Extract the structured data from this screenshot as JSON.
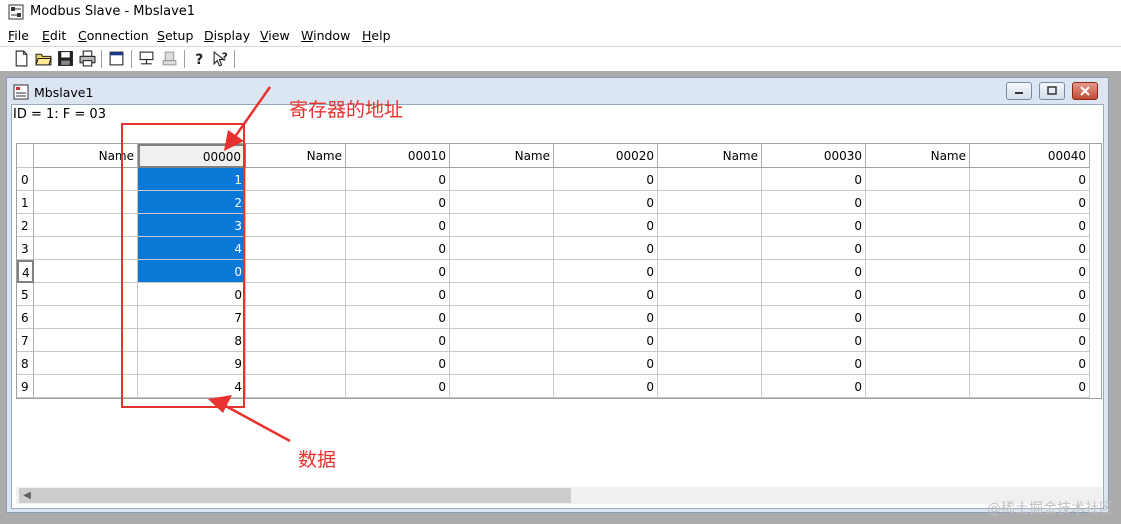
{
  "app": {
    "title": "Modbus Slave - Mbslave1"
  },
  "menu": {
    "items": [
      "File",
      "Edit",
      "Connection",
      "Setup",
      "Display",
      "View",
      "Window",
      "Help"
    ]
  },
  "toolbar": {
    "buttons": [
      "new-icon",
      "open-icon",
      "save-icon",
      "print-icon",
      "window-icon",
      "connect-icon",
      "disconnect-icon",
      "help-icon",
      "context-help-icon"
    ]
  },
  "child_window": {
    "title": "Mbslave1",
    "status": "ID = 1: F = 03",
    "colors": {
      "selection": "#0a78d7",
      "annotation": "#e8322f"
    }
  },
  "grid": {
    "headers": [
      "Name",
      "00000",
      "Name",
      "00010",
      "Name",
      "00020",
      "Name",
      "00030",
      "Name",
      "00040"
    ],
    "row_labels": [
      "0",
      "1",
      "2",
      "3",
      "4",
      "5",
      "6",
      "7",
      "8",
      "9"
    ],
    "rows": [
      [
        "",
        "1",
        "",
        "0",
        "",
        "0",
        "",
        "0",
        "",
        "0"
      ],
      [
        "",
        "2",
        "",
        "0",
        "",
        "0",
        "",
        "0",
        "",
        "0"
      ],
      [
        "",
        "3",
        "",
        "0",
        "",
        "0",
        "",
        "0",
        "",
        "0"
      ],
      [
        "",
        "4",
        "",
        "0",
        "",
        "0",
        "",
        "0",
        "",
        "0"
      ],
      [
        "",
        "0",
        "",
        "0",
        "",
        "0",
        "",
        "0",
        "",
        "0"
      ],
      [
        "",
        "0",
        "",
        "0",
        "",
        "0",
        "",
        "0",
        "",
        "0"
      ],
      [
        "",
        "7",
        "",
        "0",
        "",
        "0",
        "",
        "0",
        "",
        "0"
      ],
      [
        "",
        "8",
        "",
        "0",
        "",
        "0",
        "",
        "0",
        "",
        "0"
      ],
      [
        "",
        "9",
        "",
        "0",
        "",
        "0",
        "",
        "0",
        "",
        "0"
      ],
      [
        "",
        "4",
        "",
        "0",
        "",
        "0",
        "",
        "0",
        "",
        "0"
      ]
    ],
    "selected_rows": [
      0,
      1,
      2,
      3,
      4
    ],
    "selected_col": 1
  },
  "annotations": {
    "register_address": "寄存器的地址",
    "data": "数据"
  },
  "watermark": "@稀土掘金技术社区"
}
